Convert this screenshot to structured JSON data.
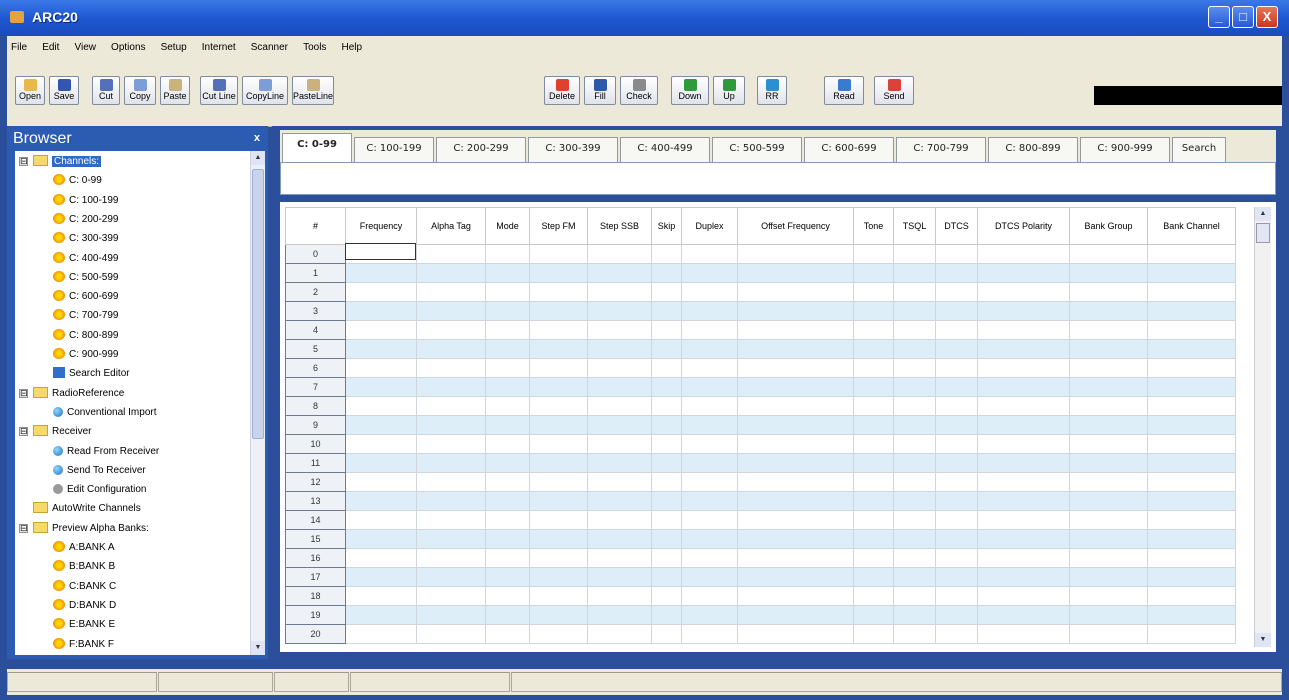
{
  "window": {
    "title": "ARC20",
    "minimize": "_",
    "maximize": "□",
    "close": "X"
  },
  "menu": [
    "File",
    "Edit",
    "View",
    "Options",
    "Setup",
    "Internet",
    "Scanner",
    "Tools",
    "Help"
  ],
  "toolbar": [
    {
      "label": "Open",
      "icon": "open-folder-icon",
      "color": "#e8b84a"
    },
    {
      "label": "Save",
      "icon": "floppy-disk-icon",
      "color": "#3455b0"
    },
    {
      "label": "Cut",
      "icon": "scissors-icon",
      "color": "#5470b8"
    },
    {
      "label": "Copy",
      "icon": "copy-icon",
      "color": "#7c9dd8"
    },
    {
      "label": "Paste",
      "icon": "paste-icon",
      "color": "#c9b27c"
    },
    {
      "label": "Cut Line",
      "icon": "cut-line-icon",
      "color": "#5470b8"
    },
    {
      "label": "CopyLine",
      "icon": "copy-line-icon",
      "color": "#7c9dd8"
    },
    {
      "label": "PasteLine",
      "icon": "paste-line-icon",
      "color": "#c9b27c"
    },
    {
      "label": "Delete",
      "icon": "delete-x-icon",
      "color": "#e0412f"
    },
    {
      "label": "Fill",
      "icon": "fill-icon",
      "color": "#2c5aa8"
    },
    {
      "label": "Check",
      "icon": "check-icon",
      "color": "#8a8a8a"
    },
    {
      "label": "Down",
      "icon": "arrow-down-icon",
      "color": "#2f9a3b"
    },
    {
      "label": "Up",
      "icon": "arrow-up-icon",
      "color": "#2f9a3b"
    },
    {
      "label": "RR",
      "icon": "globe-icon",
      "color": "#2b8fd0"
    },
    {
      "label": "Read",
      "icon": "read-radio-icon",
      "color": "#3a7ad0"
    },
    {
      "label": "Send",
      "icon": "send-radio-icon",
      "color": "#d8423a"
    }
  ],
  "browser": {
    "title": "Browser",
    "close": "x",
    "tree": [
      {
        "label": "Channels:",
        "icon": "folder",
        "expander": "⊟",
        "level": 0,
        "selected": true
      },
      {
        "label": "C: 0-99",
        "icon": "star",
        "level": 1
      },
      {
        "label": "C: 100-199",
        "icon": "star",
        "level": 1
      },
      {
        "label": "C: 200-299",
        "icon": "star",
        "level": 1
      },
      {
        "label": "C: 300-399",
        "icon": "star",
        "level": 1
      },
      {
        "label": "C: 400-499",
        "icon": "star",
        "level": 1
      },
      {
        "label": "C: 500-599",
        "icon": "star",
        "level": 1
      },
      {
        "label": "C: 600-699",
        "icon": "star",
        "level": 1
      },
      {
        "label": "C: 700-799",
        "icon": "star",
        "level": 1
      },
      {
        "label": "C: 800-899",
        "icon": "star",
        "level": 1
      },
      {
        "label": "C: 900-999",
        "icon": "star",
        "level": 1
      },
      {
        "label": "Search Editor",
        "icon": "search",
        "level": 1
      },
      {
        "label": "RadioReference",
        "icon": "folder",
        "expander": "⊟",
        "level": 0
      },
      {
        "label": "Conventional Import",
        "icon": "globe",
        "level": 1
      },
      {
        "label": "Receiver",
        "icon": "folder",
        "expander": "⊟",
        "level": 0
      },
      {
        "label": "Read From Receiver",
        "icon": "globe",
        "level": 1
      },
      {
        "label": "Send To Receiver",
        "icon": "globe",
        "level": 1
      },
      {
        "label": "Edit Configuration",
        "icon": "gear",
        "level": 1
      },
      {
        "label": "AutoWrite Channels",
        "icon": "folder",
        "level": 0
      },
      {
        "label": "Preview Alpha Banks:",
        "icon": "folder",
        "expander": "⊟",
        "level": 0
      },
      {
        "label": "A:BANK A",
        "icon": "star",
        "level": 1
      },
      {
        "label": "B:BANK B",
        "icon": "star",
        "level": 1
      },
      {
        "label": "C:BANK C",
        "icon": "star",
        "level": 1
      },
      {
        "label": "D:BANK D",
        "icon": "star",
        "level": 1
      },
      {
        "label": "E:BANK E",
        "icon": "star",
        "level": 1
      },
      {
        "label": "F:BANK F",
        "icon": "star",
        "level": 1
      }
    ]
  },
  "tabs": [
    "C: 0-99",
    "C: 100-199",
    "C: 200-299",
    "C: 300-399",
    "C: 400-499",
    "C: 500-599",
    "C: 600-699",
    "C: 700-799",
    "C: 800-899",
    "C: 900-999",
    "Search"
  ],
  "grid": {
    "columns": [
      "#",
      "Frequency",
      "Alpha Tag",
      "Mode",
      "Step FM",
      "Step SSB",
      "Skip",
      "Duplex",
      "Offset Frequency",
      "Tone",
      "TSQL",
      "DTCS",
      "DTCS Polarity",
      "Bank Group",
      "Bank Channel"
    ],
    "rows": [
      "0",
      "1",
      "2",
      "3",
      "4",
      "5",
      "6",
      "7",
      "8",
      "9",
      "10",
      "11",
      "12",
      "13",
      "14",
      "15",
      "16",
      "17",
      "18",
      "19",
      "20"
    ],
    "scroll_up": "▲",
    "scroll_down": "▼"
  }
}
